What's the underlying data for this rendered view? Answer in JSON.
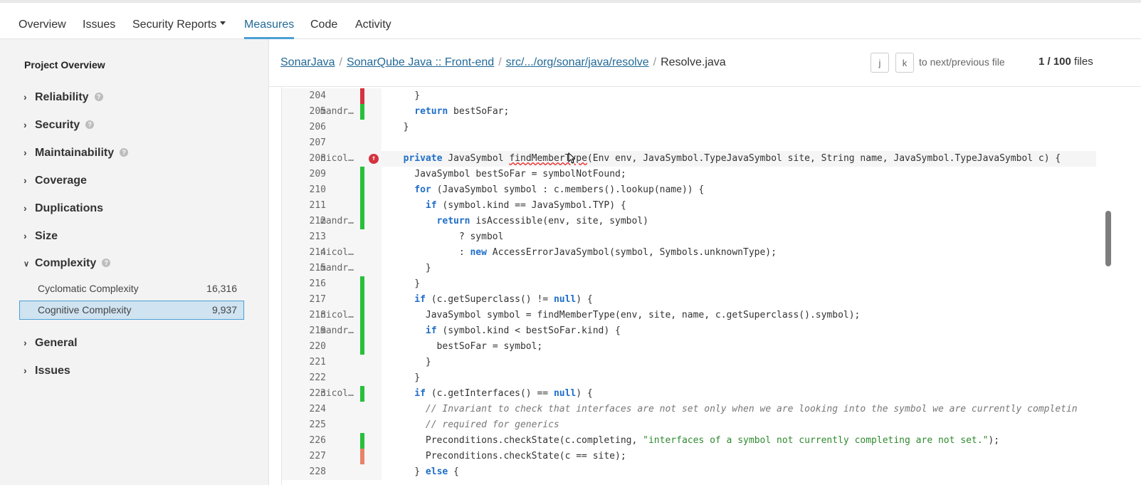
{
  "nav": {
    "tabs": [
      {
        "label": "Overview",
        "active": false
      },
      {
        "label": "Issues",
        "active": false
      },
      {
        "label": "Security Reports",
        "active": false,
        "dropdown": true
      },
      {
        "label": "Measures",
        "active": true
      },
      {
        "label": "Code",
        "active": false
      },
      {
        "label": "Activity",
        "active": false
      }
    ]
  },
  "sidebar": {
    "title": "Project Overview",
    "categories": [
      {
        "label": "Reliability",
        "expanded": false,
        "help": true
      },
      {
        "label": "Security",
        "expanded": false,
        "help": true
      },
      {
        "label": "Maintainability",
        "expanded": false,
        "help": true
      },
      {
        "label": "Coverage",
        "expanded": false,
        "help": false
      },
      {
        "label": "Duplications",
        "expanded": false,
        "help": false
      },
      {
        "label": "Size",
        "expanded": false,
        "help": false
      },
      {
        "label": "Complexity",
        "expanded": true,
        "help": true
      },
      {
        "label": "General",
        "expanded": false,
        "help": false
      },
      {
        "label": "Issues",
        "expanded": false,
        "help": false
      }
    ],
    "metrics": [
      {
        "label": "Cyclomatic Complexity",
        "value": "16,316",
        "selected": false
      },
      {
        "label": "Cognitive Complexity",
        "value": "9,937",
        "selected": true
      }
    ]
  },
  "breadcrumb": {
    "items": [
      {
        "label": "SonarJava",
        "link": true
      },
      {
        "label": "SonarQube Java :: Front-end",
        "link": true
      },
      {
        "label": "src/.../org/sonar/java/resolve",
        "link": true
      },
      {
        "label": "Resolve.java",
        "link": false
      }
    ],
    "separator": "/"
  },
  "pager": {
    "key_next": "j",
    "key_prev": "k",
    "hint": "to next/previous file",
    "count_bold": "1 / 100",
    "count_suffix": "files"
  },
  "colors": {
    "accent": "#236a97",
    "active_underline": "#4b9fd5",
    "covered": "#27c03a",
    "uncovered": "#d4333f",
    "partial": "#e8836b",
    "selected_bg": "#cfe3f1"
  },
  "code": {
    "lines": [
      {
        "num": "204",
        "blame": "",
        "cov": "uncovered",
        "issue": false,
        "indent": 2,
        "tokens": [
          {
            "t": "}"
          }
        ]
      },
      {
        "num": "205",
        "blame": "mandr…",
        "cov": "covered",
        "issue": false,
        "indent": 2,
        "tokens": [
          {
            "t": "return",
            "k": "kw"
          },
          {
            "t": " bestSoFar;"
          }
        ]
      },
      {
        "num": "206",
        "blame": "",
        "cov": "",
        "issue": false,
        "indent": 1,
        "tokens": [
          {
            "t": "}"
          }
        ]
      },
      {
        "num": "207",
        "blame": "",
        "cov": "",
        "issue": false,
        "indent": 0,
        "tokens": []
      },
      {
        "num": "208",
        "blame": "nicol…",
        "cov": "",
        "issue": true,
        "indent": 1,
        "hl": true,
        "tokens": [
          {
            "t": "private",
            "k": "kw"
          },
          {
            "t": " JavaSymbol "
          },
          {
            "t": "findMemberType",
            "k": "squig"
          },
          {
            "t": "(Env env, JavaSymbol.TypeJavaSymbol site, String name, JavaSymbol.TypeJavaSymbol c) {"
          }
        ]
      },
      {
        "num": "209",
        "blame": "",
        "cov": "covered",
        "issue": false,
        "indent": 2,
        "tokens": [
          {
            "t": "JavaSymbol bestSoFar = symbolNotFound;"
          }
        ]
      },
      {
        "num": "210",
        "blame": "",
        "cov": "covered",
        "issue": false,
        "indent": 2,
        "tokens": [
          {
            "t": "for",
            "k": "kw"
          },
          {
            "t": " (JavaSymbol symbol : c.members().lookup(name)) {"
          }
        ]
      },
      {
        "num": "211",
        "blame": "",
        "cov": "covered",
        "issue": false,
        "indent": 3,
        "tokens": [
          {
            "t": "if",
            "k": "kw"
          },
          {
            "t": " (symbol.kind == JavaSymbol.TYP) {"
          }
        ]
      },
      {
        "num": "212",
        "blame": "mandr…",
        "cov": "covered",
        "issue": false,
        "indent": 4,
        "tokens": [
          {
            "t": "return",
            "k": "kw"
          },
          {
            "t": " isAccessible(env, site, symbol)"
          }
        ]
      },
      {
        "num": "213",
        "blame": "",
        "cov": "",
        "issue": false,
        "indent": 6,
        "tokens": [
          {
            "t": "? symbol"
          }
        ]
      },
      {
        "num": "214",
        "blame": "nicol…",
        "cov": "",
        "issue": false,
        "indent": 6,
        "tokens": [
          {
            "t": ": "
          },
          {
            "t": "new",
            "k": "kw"
          },
          {
            "t": " AccessErrorJavaSymbol(symbol, Symbols.unknownType);"
          }
        ]
      },
      {
        "num": "215",
        "blame": "mandr…",
        "cov": "",
        "issue": false,
        "indent": 3,
        "tokens": [
          {
            "t": "}"
          }
        ]
      },
      {
        "num": "216",
        "blame": "",
        "cov": "covered",
        "issue": false,
        "indent": 2,
        "tokens": [
          {
            "t": "}"
          }
        ]
      },
      {
        "num": "217",
        "blame": "",
        "cov": "covered",
        "issue": false,
        "indent": 2,
        "tokens": [
          {
            "t": "if",
            "k": "kw"
          },
          {
            "t": " (c.getSuperclass() != "
          },
          {
            "t": "null",
            "k": "kw"
          },
          {
            "t": ") {"
          }
        ]
      },
      {
        "num": "218",
        "blame": "nicol…",
        "cov": "covered",
        "issue": false,
        "indent": 3,
        "tokens": [
          {
            "t": "JavaSymbol symbol = findMemberType(env, site, name, c.getSuperclass().symbol);"
          }
        ]
      },
      {
        "num": "219",
        "blame": "mandr…",
        "cov": "covered",
        "issue": false,
        "indent": 3,
        "tokens": [
          {
            "t": "if",
            "k": "kw"
          },
          {
            "t": " (symbol.kind < bestSoFar.kind) {"
          }
        ]
      },
      {
        "num": "220",
        "blame": "",
        "cov": "covered",
        "issue": false,
        "indent": 4,
        "tokens": [
          {
            "t": "bestSoFar = symbol;"
          }
        ]
      },
      {
        "num": "221",
        "blame": "",
        "cov": "",
        "issue": false,
        "indent": 3,
        "tokens": [
          {
            "t": "}"
          }
        ]
      },
      {
        "num": "222",
        "blame": "",
        "cov": "",
        "issue": false,
        "indent": 2,
        "tokens": [
          {
            "t": "}"
          }
        ]
      },
      {
        "num": "223",
        "blame": "nicol…",
        "cov": "covered",
        "issue": false,
        "indent": 2,
        "tokens": [
          {
            "t": "if",
            "k": "kw"
          },
          {
            "t": " (c.getInterfaces() == "
          },
          {
            "t": "null",
            "k": "kw"
          },
          {
            "t": ") {"
          }
        ]
      },
      {
        "num": "224",
        "blame": "",
        "cov": "",
        "issue": false,
        "indent": 3,
        "tokens": [
          {
            "t": "// Invariant to check that interfaces are not set only when we are looking into the symbol we are currently completin",
            "k": "cmt"
          }
        ]
      },
      {
        "num": "225",
        "blame": "",
        "cov": "",
        "issue": false,
        "indent": 3,
        "tokens": [
          {
            "t": "// required for generics",
            "k": "cmt"
          }
        ]
      },
      {
        "num": "226",
        "blame": "",
        "cov": "covered",
        "issue": false,
        "indent": 3,
        "tokens": [
          {
            "t": "Preconditions.checkState(c.completing, "
          },
          {
            "t": "\"interfaces of a symbol not currently completing are not set.\"",
            "k": "str"
          },
          {
            "t": ");"
          }
        ]
      },
      {
        "num": "227",
        "blame": "",
        "cov": "partial",
        "issue": false,
        "indent": 3,
        "tokens": [
          {
            "t": "Preconditions.checkState(c == site);"
          }
        ]
      },
      {
        "num": "228",
        "blame": "",
        "cov": "",
        "issue": false,
        "indent": 2,
        "tokens": [
          {
            "t": "} "
          },
          {
            "t": "else",
            "k": "kw"
          },
          {
            "t": " {"
          }
        ]
      }
    ]
  }
}
